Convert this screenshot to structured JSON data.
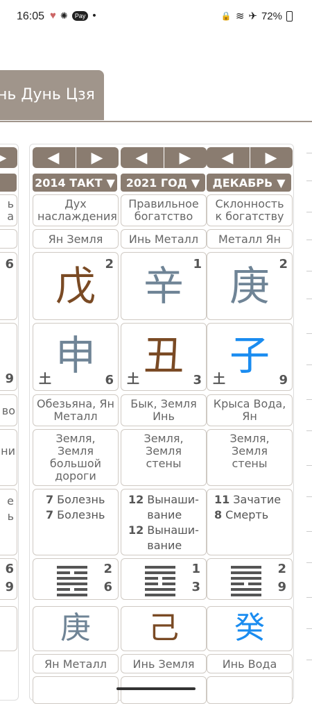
{
  "status": {
    "time": "16:05",
    "battery": "72%"
  },
  "tab": {
    "title": "нь Дунь Цзя"
  },
  "columns": [
    {
      "selector": "2014 ТАКТ",
      "god": "Дух наслаждения",
      "stem_elem": "Ян Земля",
      "stem": "戊",
      "stem_num": "2",
      "branch": "申",
      "branch_elem": "土",
      "branch_num": "6",
      "branch_name": "Обезьяна, Ян Металл",
      "nayin": "Земля, Земля большой дороги",
      "life": [
        {
          "n": "7",
          "t": "Болезнь"
        },
        {
          "n": "7",
          "t": "Болезнь"
        }
      ],
      "hex": [
        "yang",
        "yin",
        "yang",
        "yang",
        "yin",
        "yang"
      ],
      "hex_top": "2",
      "hex_bottom": "6",
      "hidden": "庚",
      "hidden_elem": "Ян Металл"
    },
    {
      "selector": "2021 ГОД",
      "god": "Правильное богатство",
      "stem_elem": "Инь Металл",
      "stem": "辛",
      "stem_num": "1",
      "branch": "丑",
      "branch_elem": "土",
      "branch_num": "3",
      "branch_name": "Бык, Земля Инь",
      "nayin": "Земля, Земля стены",
      "life": [
        {
          "n": "12",
          "t": "Вынаши-вание"
        },
        {
          "n": "12",
          "t": "Вынаши-вание"
        }
      ],
      "hex": [
        "yang",
        "yang",
        "yin",
        "yin",
        "yang",
        "yang"
      ],
      "hex_top": "1",
      "hex_bottom": "3",
      "hidden": "己",
      "hidden_elem": "Инь Земля"
    },
    {
      "selector": "ДЕКАБРЬ",
      "god": "Склонность к богатству",
      "stem_elem": "Металл Ян",
      "stem": "庚",
      "stem_num": "2",
      "branch": "子",
      "branch_elem": "土",
      "branch_num": "9",
      "branch_name": "Крыса Вода, Ян",
      "nayin": "Земля, Земля стены",
      "life": [
        {
          "n": "11",
          "t": "Зачатие"
        },
        {
          "n": "8",
          "t": "Смерть"
        }
      ],
      "hex": [
        "yang",
        "yang",
        "yang",
        "yin",
        "yang",
        "yang"
      ],
      "hex_top": "2",
      "hex_bottom": "9",
      "hidden": "癸",
      "hidden_elem": "Инь Вода"
    }
  ],
  "left_partial": {
    "god": [
      "ь",
      "а"
    ],
    "stem_num": "6",
    "branch_num": "9",
    "branch_name": "во",
    "nayin": "ни",
    "life": [
      "е",
      "ь"
    ],
    "hex_top": "6",
    "hex_bottom": "9"
  },
  "colors": {
    "tab": "#a0958b",
    "button": "#8a7c70",
    "brown": "#7a4a24",
    "grey": "#6f8496",
    "blue": "#1a8cf0"
  }
}
